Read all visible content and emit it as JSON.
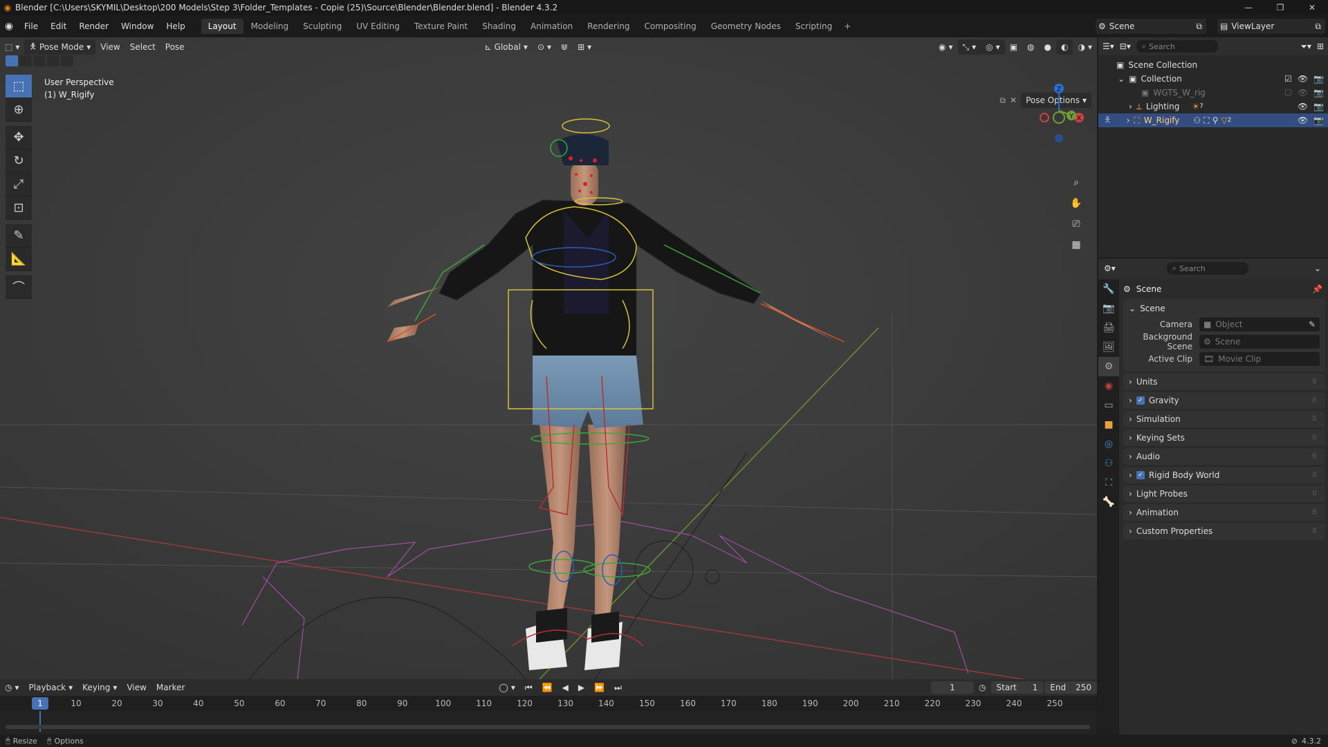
{
  "window": {
    "title": "Blender [C:\\Users\\SKYMIL\\Desktop\\200 Models\\Step 3\\Folder_Templates - Copie (25)\\Source\\Blender\\Blender.blend] - Blender 4.3.2"
  },
  "menu": [
    "File",
    "Edit",
    "Render",
    "Window",
    "Help"
  ],
  "workspaces": [
    {
      "label": "Layout",
      "active": true
    },
    {
      "label": "Modeling"
    },
    {
      "label": "Sculpting"
    },
    {
      "label": "UV Editing"
    },
    {
      "label": "Texture Paint"
    },
    {
      "label": "Shading"
    },
    {
      "label": "Animation"
    },
    {
      "label": "Rendering"
    },
    {
      "label": "Compositing"
    },
    {
      "label": "Geometry Nodes"
    },
    {
      "label": "Scripting"
    }
  ],
  "scene_selector": "Scene",
  "viewlayer_selector": "ViewLayer",
  "viewport": {
    "mode": "Pose Mode",
    "menus": [
      "View",
      "Select",
      "Pose"
    ],
    "orientation": "Global",
    "pose_options": "Pose Options",
    "info_line1": "User Perspective",
    "info_line2": "(1) W_Rigify",
    "axis_x": "X",
    "axis_y": "Y",
    "axis_z": "Z"
  },
  "outliner": {
    "search_placeholder": "Search",
    "rows": [
      {
        "label": "Scene Collection"
      },
      {
        "label": "Collection"
      },
      {
        "label": "WGTS_W_rig"
      },
      {
        "label": "Lighting",
        "badge": "7"
      },
      {
        "label": "W_Rigify",
        "badge": "2"
      }
    ]
  },
  "properties": {
    "search_placeholder": "Search",
    "context": "Scene",
    "scene_panel": "Scene",
    "camera_label": "Camera",
    "camera_value": "Object",
    "bg_scene_label": "Background Scene",
    "bg_scene_value": "Scene",
    "active_clip_label": "Active Clip",
    "active_clip_value": "Movie Clip",
    "panels": [
      "Units",
      "Gravity",
      "Simulation",
      "Keying Sets",
      "Audio",
      "Rigid Body World",
      "Light Probes",
      "Animation",
      "Custom Properties"
    ]
  },
  "timeline": {
    "menus": [
      "Playback",
      "Keying",
      "View",
      "Marker"
    ],
    "current_frame": "1",
    "start_label": "Start",
    "start": "1",
    "end_label": "End",
    "end": "250",
    "ticks": [
      "1",
      "10",
      "20",
      "30",
      "40",
      "50",
      "60",
      "70",
      "80",
      "90",
      "100",
      "110",
      "120",
      "130",
      "140",
      "150",
      "160",
      "170",
      "180",
      "190",
      "200",
      "210",
      "220",
      "230",
      "240",
      "250"
    ]
  },
  "status": {
    "resize": "Resize",
    "options": "Options",
    "version": "4.3.2"
  }
}
